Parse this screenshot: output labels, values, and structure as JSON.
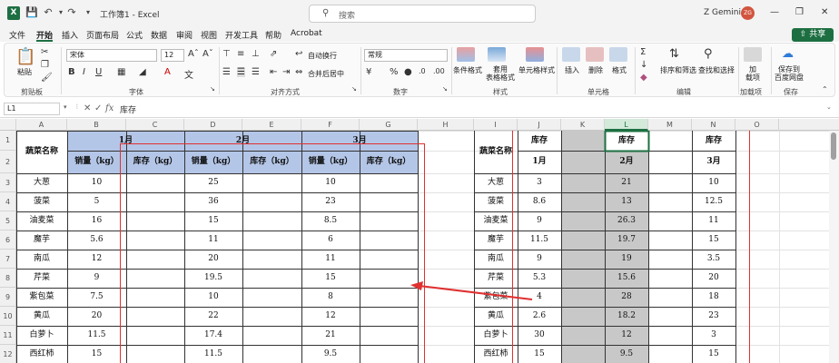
{
  "titlebar": {
    "doc_title": "工作簿1  -  Excel",
    "search_placeholder": "搜索",
    "user_name": "Z Gemini",
    "avatar_initials": "ZG"
  },
  "menu": {
    "tabs": [
      "文件",
      "开始",
      "插入",
      "页面布局",
      "公式",
      "数据",
      "审阅",
      "视图",
      "开发工具",
      "帮助",
      "Acrobat"
    ],
    "share_label": "共享"
  },
  "ribbon": {
    "paste_label": "粘贴",
    "clipboard_label": "剪贴板",
    "font_name": "宋体",
    "font_size": "12",
    "font_label": "字体",
    "wrap_text": "自动换行",
    "merge_center": "合并后居中",
    "alignment_label": "对齐方式",
    "number_format": "常规",
    "number_label": "数字",
    "cond_format": "条件格式",
    "table_format": "套用\n表格格式",
    "cell_styles": "单元格样式",
    "styles_label": "样式",
    "insert": "插入",
    "delete": "删除",
    "format": "格式",
    "cells_label": "单元格",
    "sort_filter": "排序和筛选",
    "find_select": "查找和选择",
    "editing_label": "编辑",
    "addins": "加\n载项",
    "addins_label": "加载项",
    "save_baidu": "保存到\n百度网盘",
    "save_label": "保存"
  },
  "formula_bar": {
    "name_box": "L1",
    "formula": "库存"
  },
  "columns": [
    "A",
    "B",
    "C",
    "D",
    "E",
    "F",
    "G",
    "H",
    "I",
    "J",
    "K",
    "L",
    "M",
    "N",
    "O"
  ],
  "rows": [
    "1",
    "2",
    "3",
    "4",
    "5",
    "6",
    "7",
    "8",
    "9",
    "10",
    "11",
    "12"
  ],
  "left_table": {
    "name_header": "蔬菜名称",
    "months": [
      "1月",
      "2月",
      "3月"
    ],
    "sub_headers": [
      "销量（kg）",
      "库存（kg）",
      "销量（kg）",
      "库存（kg）",
      "销量（kg）",
      "库存（kg）"
    ],
    "rows": [
      {
        "name": "大葱",
        "m1": "10",
        "m2": "25",
        "m3": "10"
      },
      {
        "name": "菠菜",
        "m1": "5",
        "m2": "36",
        "m3": "23"
      },
      {
        "name": "油麦菜",
        "m1": "16",
        "m2": "15",
        "m3": "8.5"
      },
      {
        "name": "魔芋",
        "m1": "5.6",
        "m2": "11",
        "m3": "6"
      },
      {
        "name": "南瓜",
        "m1": "12",
        "m2": "20",
        "m3": "11"
      },
      {
        "name": "芹菜",
        "m1": "9",
        "m2": "19.5",
        "m3": "15"
      },
      {
        "name": "紫包菜",
        "m1": "7.5",
        "m2": "10",
        "m3": "8"
      },
      {
        "name": "黄瓜",
        "m1": "20",
        "m2": "22",
        "m3": "12"
      },
      {
        "name": "白萝卜",
        "m1": "11.5",
        "m2": "17.4",
        "m3": "21"
      },
      {
        "name": "西红柿",
        "m1": "15",
        "m2": "11.5",
        "m3": "9.5"
      }
    ]
  },
  "right_table": {
    "name_header": "蔬菜名称",
    "stock_label": "库存",
    "months": [
      "1月",
      "2月",
      "3月"
    ],
    "rows": [
      {
        "name": "大葱",
        "m1": "3",
        "m2": "21",
        "m3": "10"
      },
      {
        "name": "菠菜",
        "m1": "8.6",
        "m2": "13",
        "m3": "12.5"
      },
      {
        "name": "油麦菜",
        "m1": "9",
        "m2": "26.3",
        "m3": "11"
      },
      {
        "name": "魔芋",
        "m1": "11.5",
        "m2": "19.7",
        "m3": "15"
      },
      {
        "name": "南瓜",
        "m1": "9",
        "m2": "19",
        "m3": "3.5"
      },
      {
        "name": "芹菜",
        "m1": "5.3",
        "m2": "15.6",
        "m3": "20"
      },
      {
        "name": "紫包菜",
        "m1": "4",
        "m2": "28",
        "m3": "18"
      },
      {
        "name": "黄瓜",
        "m1": "2.6",
        "m2": "18.2",
        "m3": "23"
      },
      {
        "name": "白萝卜",
        "m1": "30",
        "m2": "12",
        "m3": "3"
      },
      {
        "name": "西红柿",
        "m1": "15",
        "m2": "9.5",
        "m3": "15"
      }
    ]
  },
  "colors": {
    "excel_green": "#1d6f42",
    "highlight_red": "#e03030",
    "gray_fill": "#c8c8c8",
    "header_fill": "#b4c6e7"
  }
}
